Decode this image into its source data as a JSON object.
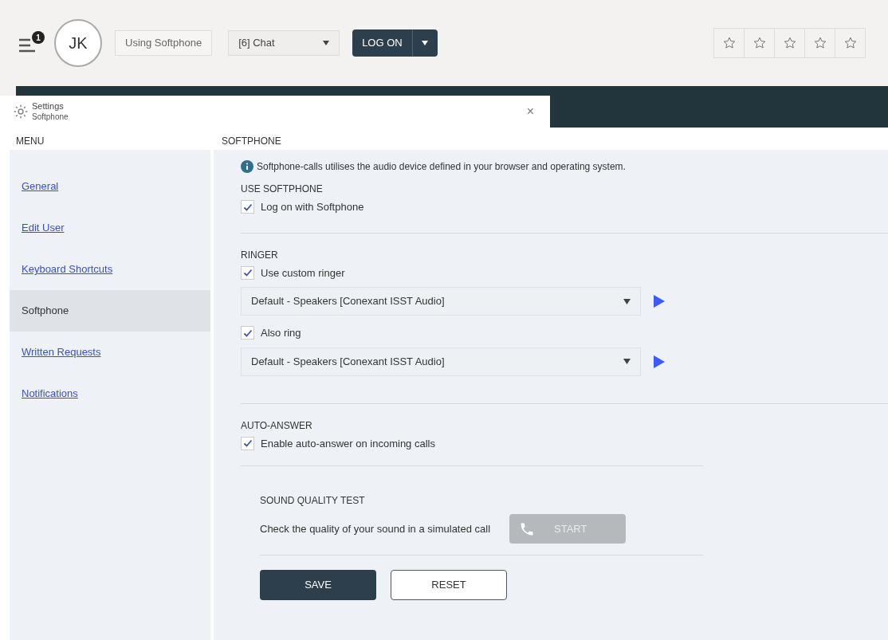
{
  "header": {
    "notifications_badge": "1",
    "avatar_initials": "JK",
    "mode": "Using Softphone",
    "channel_select": "[6] Chat",
    "logon_button": "LOG ON",
    "rating": {
      "stars": 0
    }
  },
  "tab": {
    "title": "Settings",
    "subtitle": "Softphone",
    "close": "×"
  },
  "menu": {
    "heading": "MENU",
    "items": [
      {
        "label": "General",
        "selected": false
      },
      {
        "label": "Edit User",
        "selected": false
      },
      {
        "label": "Keyboard Shortcuts",
        "selected": false
      },
      {
        "label": "Softphone",
        "selected": true
      },
      {
        "label": "Written Requests",
        "selected": false
      },
      {
        "label": "Notifications",
        "selected": false
      }
    ]
  },
  "panel": {
    "heading": "SOFTPHONE",
    "info": "Softphone-calls utilises the audio device defined in your browser and operating system.",
    "sections": [
      {
        "title": "USE SOFTPHONE",
        "rows": [
          {
            "kind": "checkbox",
            "label": "Log on with Softphone",
            "checked": true
          }
        ]
      },
      {
        "title": "RINGER",
        "rows": [
          {
            "kind": "checkbox",
            "label": "Use custom ringer",
            "checked": true
          },
          {
            "kind": "select",
            "value": "Default - Speakers [Conexant ISST Audio]"
          },
          {
            "kind": "checkbox",
            "label": "Also ring",
            "checked": true
          },
          {
            "kind": "select",
            "value": "Default - Speakers [Conexant ISST Audio]"
          }
        ]
      },
      {
        "title": "AUTO-ANSWER",
        "rows": [
          {
            "kind": "checkbox",
            "label": "Enable auto-answer on incoming calls",
            "checked": true
          }
        ]
      }
    ],
    "sound_test": {
      "title": "SOUND QUALITY TEST",
      "text": "Check the quality of your sound in a simulated call",
      "button": "START",
      "disabled": true
    },
    "buttons": {
      "save": "SAVE",
      "reset": "RESET"
    }
  }
}
